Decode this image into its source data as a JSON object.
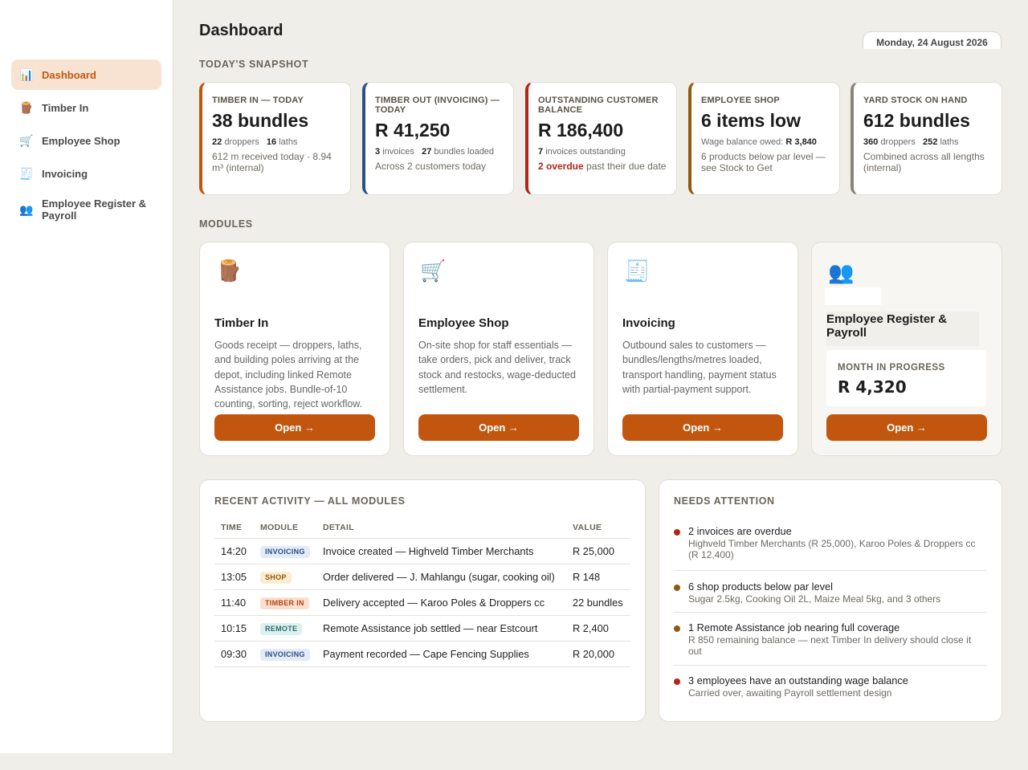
{
  "sidebar": {
    "items": [
      {
        "icon": "📊",
        "icon_name": "bar-chart-icon",
        "label": "Dashboard",
        "active": true
      },
      {
        "icon": "🪵",
        "icon_name": "wood-log-icon",
        "label": "Timber In"
      },
      {
        "icon": "🛒",
        "icon_name": "shopping-cart-icon",
        "label": "Employee Shop"
      },
      {
        "icon": "🧾",
        "icon_name": "receipt-icon",
        "label": "Invoicing"
      },
      {
        "icon": "👥",
        "icon_name": "people-icon",
        "label": "Employee Register & Payroll"
      }
    ]
  },
  "header": {
    "title": "Dashboard",
    "date": "Monday, 24 August 2026"
  },
  "snapshot": {
    "heading": "TODAY'S SNAPSHOT",
    "cards": [
      {
        "label": "TIMBER IN — TODAY",
        "value": "38 bundles",
        "accent": "#c2560f",
        "sub": [
          {
            "num": "22",
            "text": "droppers"
          },
          {
            "num": "16",
            "text": "laths"
          }
        ],
        "note": "612 m received today · 8.94 m³ (internal)"
      },
      {
        "label": "TIMBER OUT (INVOICING) — TODAY",
        "value": "R 41,250",
        "accent": "#2d4f86",
        "sub": [
          {
            "num": "3",
            "text": "invoices"
          },
          {
            "num": "27",
            "text": "bundles loaded"
          }
        ],
        "note": "Across 2 customers today"
      },
      {
        "label": "OUTSTANDING CUSTOMER BALANCE",
        "value": "R 186,400",
        "accent": "#b1251a",
        "sub": [
          {
            "num": "7",
            "text": "invoices outstanding"
          }
        ],
        "note_red": "2 overdue",
        "note": "past their due date"
      },
      {
        "label": "EMPLOYEE SHOP",
        "value": "6 items low",
        "accent": "#93590a",
        "sub_text": "Wage balance owed:",
        "sub_value": "R 3,840",
        "note": "6 products below par level — see Stock to Get"
      },
      {
        "label": "YARD STOCK ON HAND",
        "value": "612 bundles",
        "accent": "#8a8478",
        "sub": [
          {
            "num": "360",
            "text": "droppers"
          },
          {
            "num": "252",
            "text": "laths"
          }
        ],
        "note": "Combined across all lengths (internal)"
      }
    ]
  },
  "modules": {
    "heading": "MODULES",
    "cards": [
      {
        "icon": "🪵",
        "icon_name": "wood-log-icon",
        "title": "Timber In",
        "desc": "Goods receipt — droppers, laths, and building poles arriving at the depot, including linked Remote Assistance jobs. Bundle-of-10 counting, sorting, reject workflow.",
        "button": "Open →"
      },
      {
        "icon": "🛒",
        "icon_name": "shopping-cart-icon",
        "title": "Employee Shop",
        "desc": "On-site shop for staff essentials — take orders, pick and deliver, track stock and restocks, wage-deducted settlement.",
        "button": "Open →"
      },
      {
        "icon": "🧾",
        "icon_name": "receipt-icon",
        "title": "Invoicing",
        "desc": "Outbound sales to customers — bundles/lengths/metres loaded, transport handling, payment status with partial-payment support.",
        "button": "Open →"
      },
      {
        "icon": "👥",
        "icon_name": "people-icon",
        "title": "Employee Register & Payroll",
        "mip_label": "MONTH IN PROGRESS",
        "mip_value": "R 4,320",
        "button": "Open →"
      }
    ]
  },
  "activity": {
    "heading": "RECENT ACTIVITY — ALL MODULES",
    "columns": [
      "TIME",
      "MODULE",
      "DETAIL",
      "VALUE"
    ],
    "rows": [
      {
        "time": "14:20",
        "module": "INVOICING",
        "badge": "inv",
        "detail": "Invoice created — Highveld Timber Merchants",
        "value": "R 25,000"
      },
      {
        "time": "13:05",
        "module": "SHOP",
        "badge": "shop",
        "detail": "Order delivered — J. Mahlangu (sugar, cooking oil)",
        "value": "R 148"
      },
      {
        "time": "11:40",
        "module": "TIMBER IN",
        "badge": "timber",
        "detail": "Delivery accepted — Karoo Poles & Droppers cc",
        "value": "22 bundles"
      },
      {
        "time": "10:15",
        "module": "REMOTE",
        "badge": "remote",
        "detail": "Remote Assistance job settled — near Estcourt",
        "value": "R 2,400"
      },
      {
        "time": "09:30",
        "module": "INVOICING",
        "badge": "inv",
        "detail": "Payment recorded — Cape Fencing Supplies",
        "value": "R 20,000"
      }
    ]
  },
  "attention": {
    "heading": "NEEDS ATTENTION",
    "items": [
      {
        "color": "#b1251a",
        "title": "2 invoices are overdue",
        "detail": "Highveld Timber Merchants (R 25,000), Karoo Poles & Droppers cc (R 12,400)"
      },
      {
        "color": "#93590a",
        "title": "6 shop products below par level",
        "detail": "Sugar 2.5kg, Cooking Oil 2L, Maize Meal 5kg, and 3 others"
      },
      {
        "color": "#93590a",
        "title": "1 Remote Assistance job nearing full coverage",
        "detail": "R 850 remaining balance — next Timber In delivery should close it out"
      },
      {
        "color": "#b1251a",
        "title": "3 employees have an outstanding wage balance",
        "detail": "Carried over, awaiting Payroll settlement design"
      }
    ]
  }
}
